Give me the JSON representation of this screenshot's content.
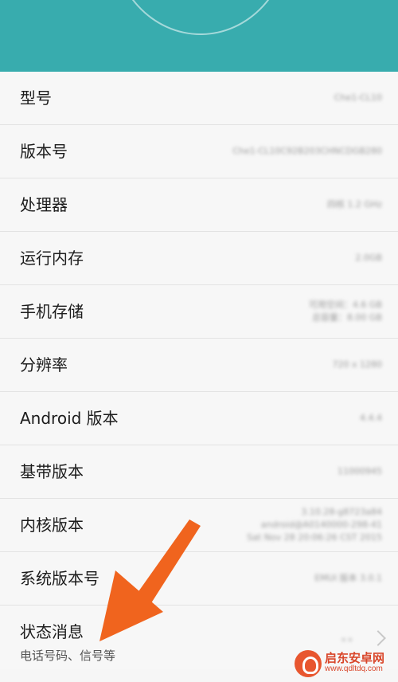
{
  "rows": [
    {
      "label": "型号",
      "value": [
        "Che1-CL10"
      ]
    },
    {
      "label": "版本号",
      "value": [
        "Che1-CL10C92B203CHNCDGB280"
      ]
    },
    {
      "label": "处理器",
      "value": [
        "四核 1.2 GHz"
      ]
    },
    {
      "label": "运行内存",
      "value": [
        "2.0GB"
      ]
    },
    {
      "label": "手机存储",
      "value": [
        "可用空间：4.6 GB",
        "总容量：8.00 GB"
      ]
    },
    {
      "label": "分辨率",
      "value": [
        "720 x 1280"
      ]
    },
    {
      "label": "Android 版本",
      "value": [
        "4.4.4"
      ]
    },
    {
      "label": "基带版本",
      "value": [
        "11000945"
      ]
    },
    {
      "label": "内核版本",
      "value": [
        "3.10.28-g8723a84",
        "android@A0140000-298-41",
        "Sat Nov 28 20:06:26 CST 2015"
      ]
    },
    {
      "label": "系统版本号",
      "value": [
        "EMUI 版本 3.0.1"
      ]
    }
  ],
  "status": {
    "label": "状态消息",
    "sub": "电话号码、信号等"
  },
  "watermark": {
    "name": "启东安卓网",
    "url": "www.qdltdq.com"
  },
  "colors": {
    "header": "#38acae",
    "arrow": "#f0641e"
  }
}
